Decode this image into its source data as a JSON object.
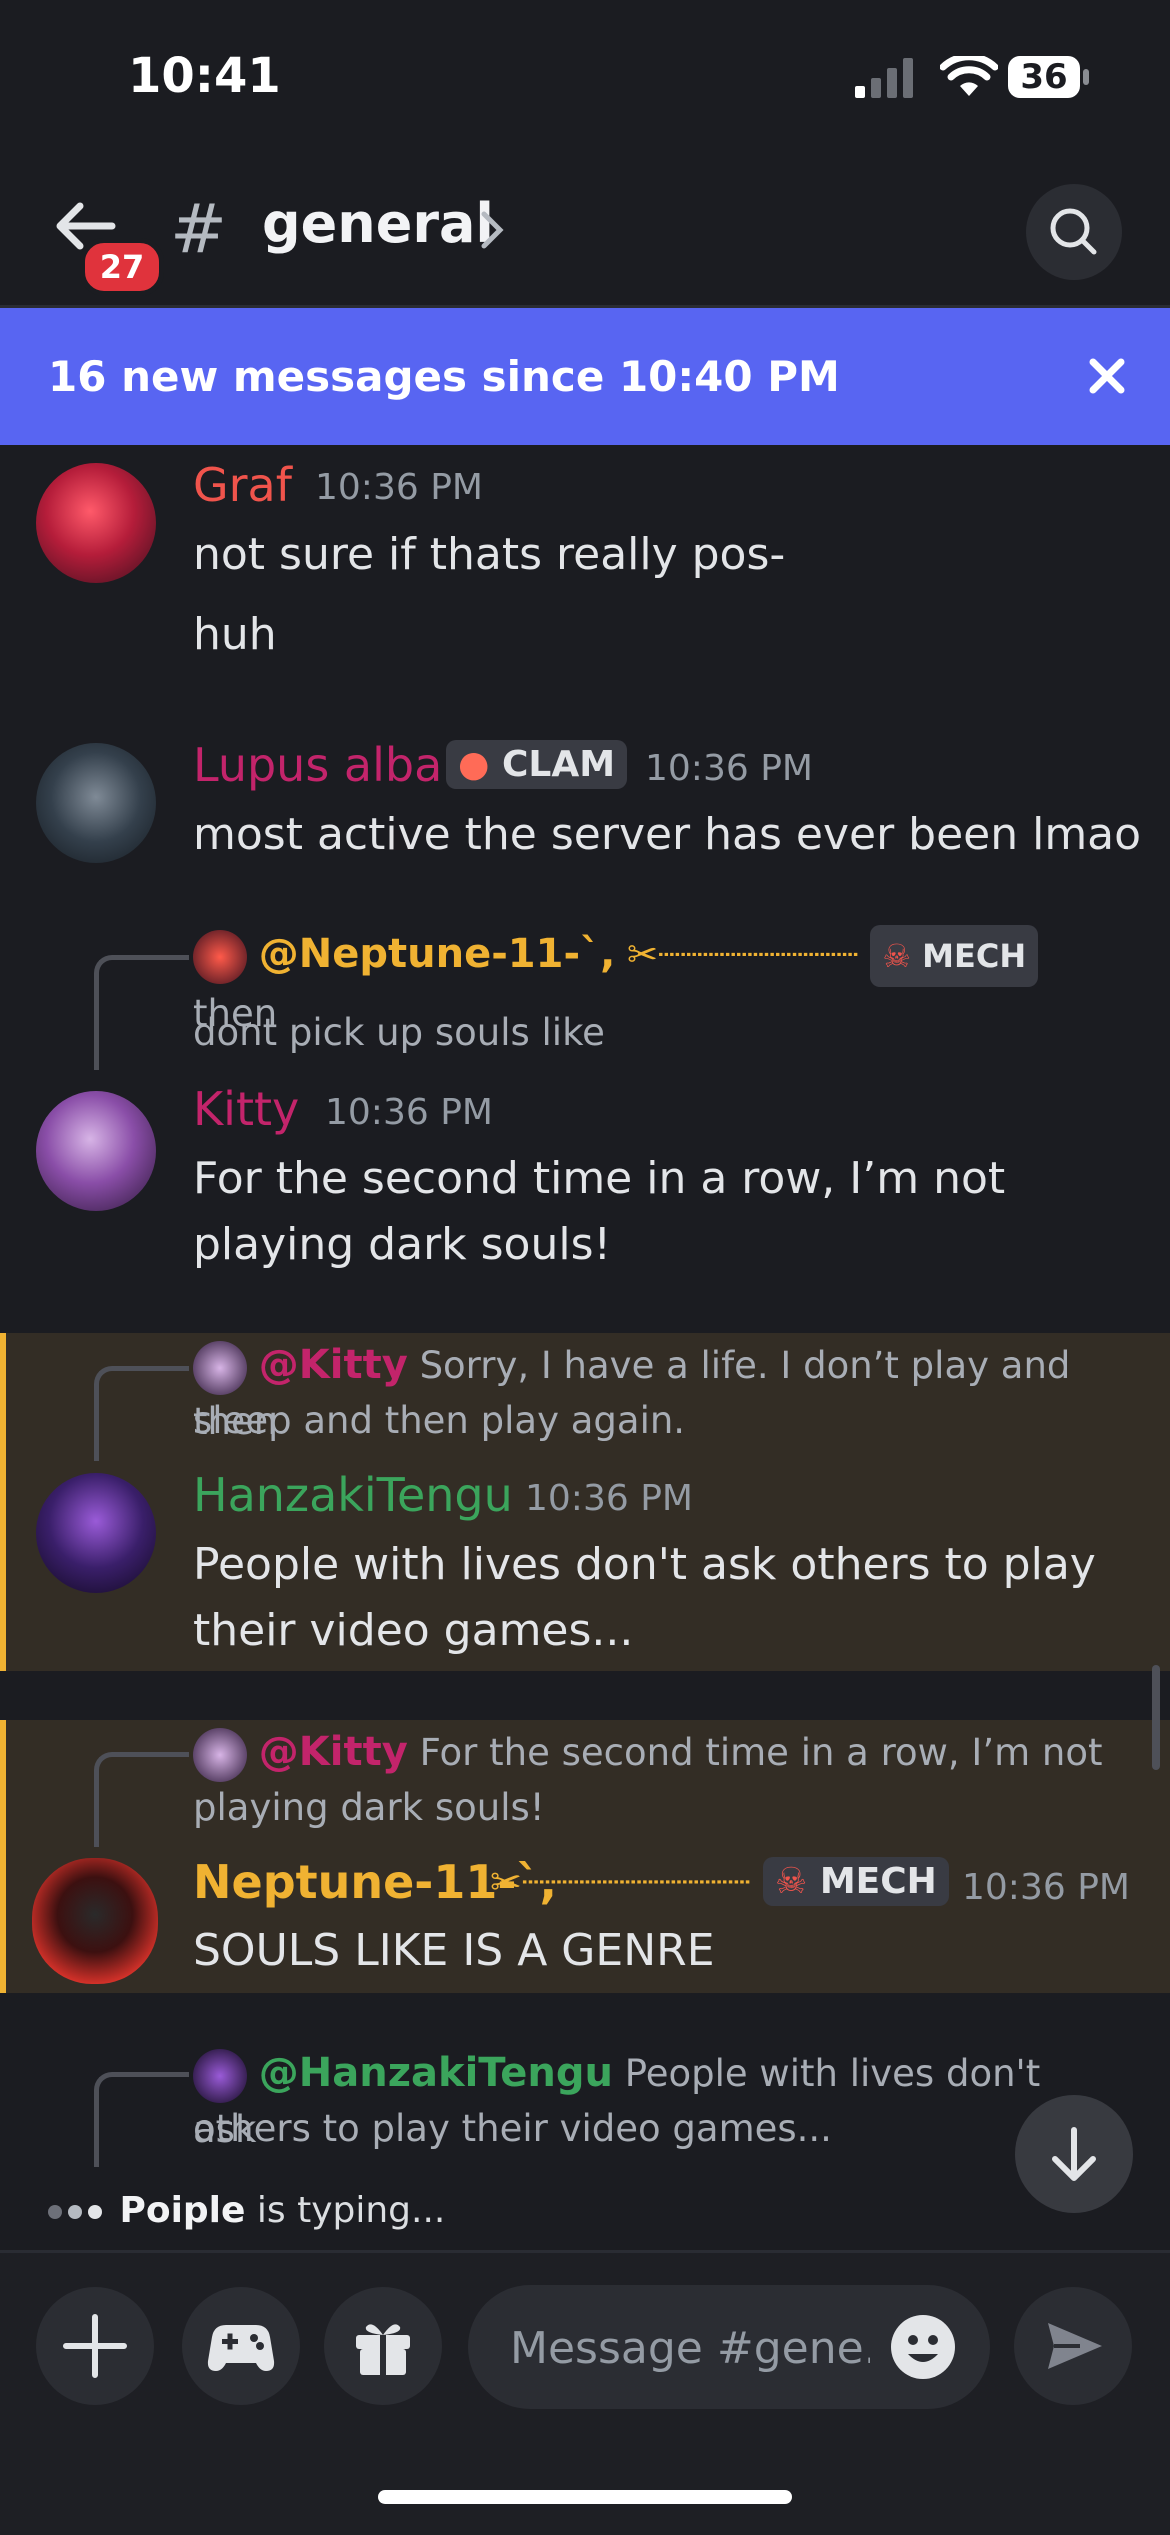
{
  "status_bar": {
    "time": "10:41",
    "battery": "36"
  },
  "header": {
    "unread_count": "27",
    "channel_name": "general",
    "hash": "#"
  },
  "banner": {
    "text": "16 new messages since 10:40 PM"
  },
  "messages": [
    {
      "username": "Graf",
      "color": "#f0544c",
      "timestamp": "10:36 PM",
      "lines": [
        "not sure if thats really pos-",
        "huh"
      ]
    },
    {
      "username": "Lupus alba",
      "color": "#c3246b",
      "tag": "CLAM",
      "timestamp": "10:36 PM",
      "lines": [
        "most active the server has ever been lmao"
      ]
    },
    {
      "reply_to": "@Neptune-11-`,",
      "reply_tag": "MECH",
      "reply_text_1": "then",
      "reply_text_2": "dont pick up souls like",
      "username": "Kitty",
      "color": "#c3246b",
      "timestamp": "10:36 PM",
      "lines": [
        "For the second time in a row, I’m not",
        "playing dark souls!"
      ]
    },
    {
      "reply_to": "@Kitty",
      "reply_text_1": "Sorry, I have a life. I don’t play and then",
      "reply_text_2": "sleep and then play again.",
      "username": "HanzakiTengu",
      "color": "#3ba55c",
      "timestamp": "10:36 PM",
      "lines": [
        "People with lives don't ask others to play",
        "their video games..."
      ]
    },
    {
      "reply_to": "@Kitty",
      "reply_text_1": "For the second time in a row, I’m not",
      "reply_text_2": "playing dark souls!",
      "username": "Neptune-11-`,",
      "color": "#f0b232",
      "tag": "MECH",
      "timestamp": "10:36 PM",
      "lines": [
        "SOULS LIKE IS A GENRE"
      ]
    },
    {
      "reply_to": "@HanzakiTengu",
      "reply_text_1": "People with lives don't ask",
      "reply_text_2": "others to play their video games..."
    }
  ],
  "typing": {
    "user": "Poiple",
    "suffix": " is typing..."
  },
  "composer": {
    "placeholder": "Message #gene..."
  }
}
